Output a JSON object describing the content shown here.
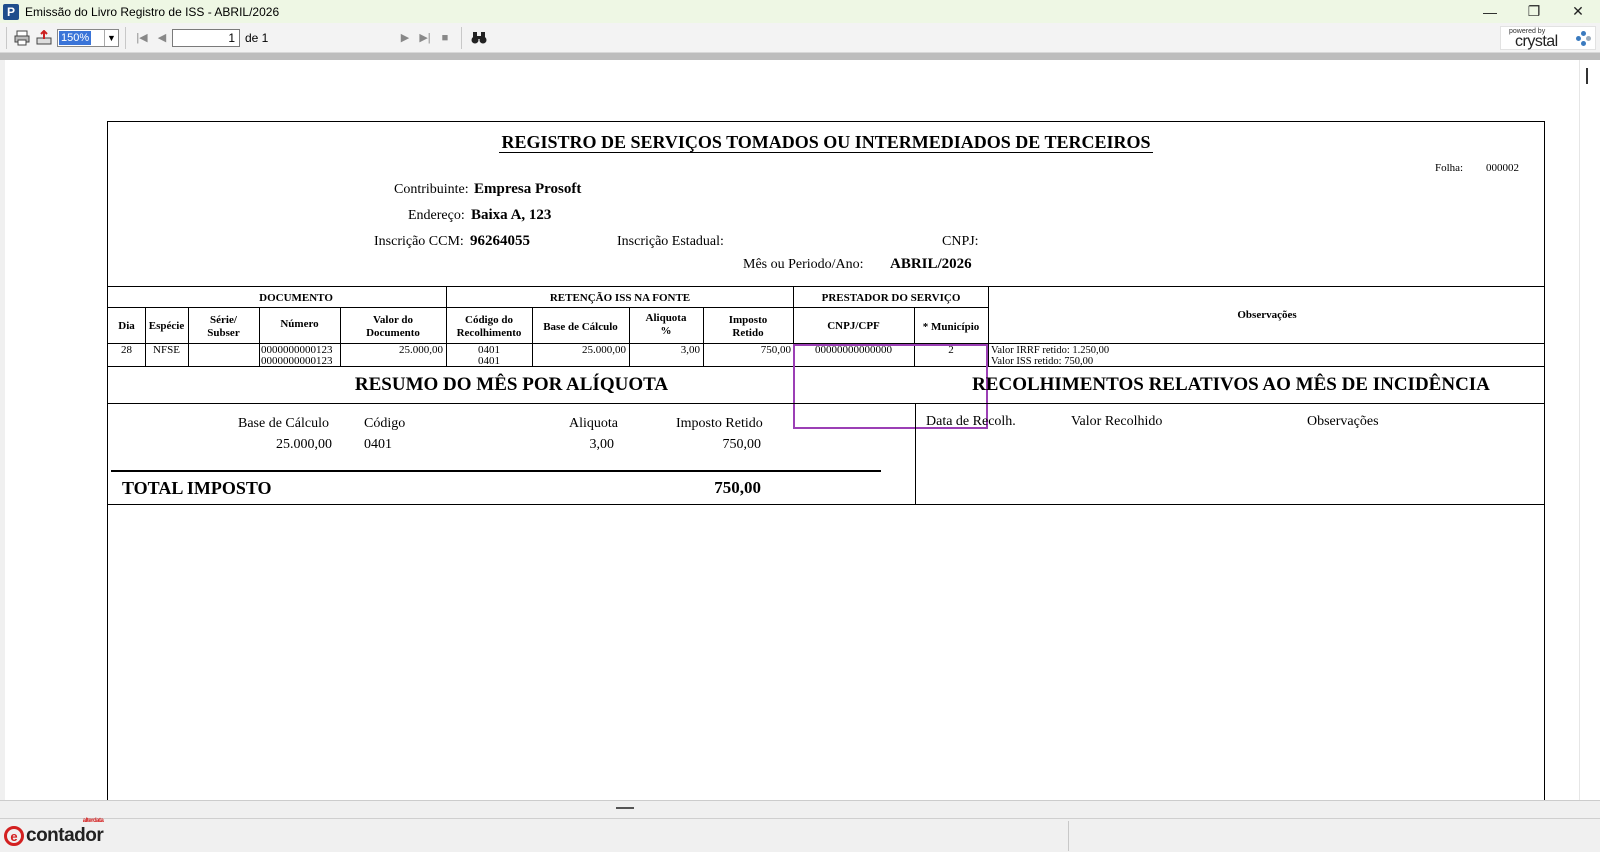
{
  "window": {
    "title": "Emissão do Livro Registro de ISS - ABRIL/2026",
    "app_icon": "P",
    "controls": {
      "minimize": "—",
      "restore": "❐",
      "close": "✕"
    }
  },
  "toolbar": {
    "zoom": "150%",
    "page_current": "1",
    "page_total": "de 1",
    "logo_powered": "powered by",
    "logo_name": "crystal"
  },
  "report": {
    "title": "REGISTRO DE SERVIÇOS TOMADOS OU INTERMEDIADOS DE TERCEIROS",
    "folha_label": "Folha:",
    "folha_value": "000002",
    "contribuinte_label": "Contribuinte:",
    "contribuinte_value": "Empresa Prosoft",
    "endereco_label": "Endereço:",
    "endereco_value": "Baixa A, 123",
    "ccm_label": "Inscrição CCM:",
    "ccm_value": "96264055",
    "ie_label": "Inscrição Estadual:",
    "cnpj_label": "CNPJ:",
    "periodo_label": "Mês ou Periodo/Ano:",
    "periodo_value": "ABRIL/2026",
    "groups": {
      "documento": "DOCUMENTO",
      "retencao": "RETENÇÃO ISS NA FONTE",
      "prestador": "PRESTADOR DO SERVIÇO",
      "observacoes": "Observações"
    },
    "columns": {
      "dia": "Dia",
      "especie": "Espécie",
      "serie_1": "Série/",
      "serie_2": "Subser",
      "numero": "Número",
      "valor_1": "Valor do",
      "valor_2": "Documento",
      "codigo_1": "Código do",
      "codigo_2": "Recolhimento",
      "base": "Base de Cálculo",
      "aliquota_1": "Aliquota",
      "aliquota_2": "%",
      "imposto_1": "Imposto",
      "imposto_2": "Retido",
      "cnpj": "CNPJ/CPF",
      "municipio": "* Município"
    },
    "row": {
      "dia": "28",
      "especie": "NFSE",
      "numero_1": "0000000000123",
      "numero_2": "0000000000123",
      "valor": "25.000,00",
      "codigo_1": "0401",
      "codigo_2": "0401",
      "base": "25.000,00",
      "aliquota": "3,00",
      "imposto": "750,00",
      "cnpj": "00000000000000",
      "municipio": "2",
      "obs_1": "Valor IRRF retido: 1.250,00",
      "obs_2": "Valor ISS retido: 750,00"
    },
    "resumo": {
      "title": "RESUMO DO MÊS POR ALÍQUOTA",
      "base_label": "Base de Cálculo",
      "codigo_label": "Código",
      "aliquota_label": "Aliquota",
      "imposto_label": "Imposto Retido",
      "base_value": "25.000,00",
      "codigo_value": "0401",
      "aliquota_value": "3,00",
      "imposto_value": "750,00",
      "total_label": "TOTAL IMPOSTO",
      "total_value": "750,00"
    },
    "recolhimentos": {
      "title": "RECOLHIMENTOS RELATIVOS AO MÊS DE INCIDÊNCIA",
      "data_label": "Data de Recolh.",
      "valor_label": "Valor Recolhido",
      "obs_label": "Observações"
    }
  },
  "statusbar": {
    "brand": "contador",
    "brand_sup": "alterdata",
    "brand_e": "e"
  },
  "colors": {
    "highlight": "#9b3fb5",
    "titlebar": "#eef7e4",
    "brand_red": "#d32020"
  }
}
